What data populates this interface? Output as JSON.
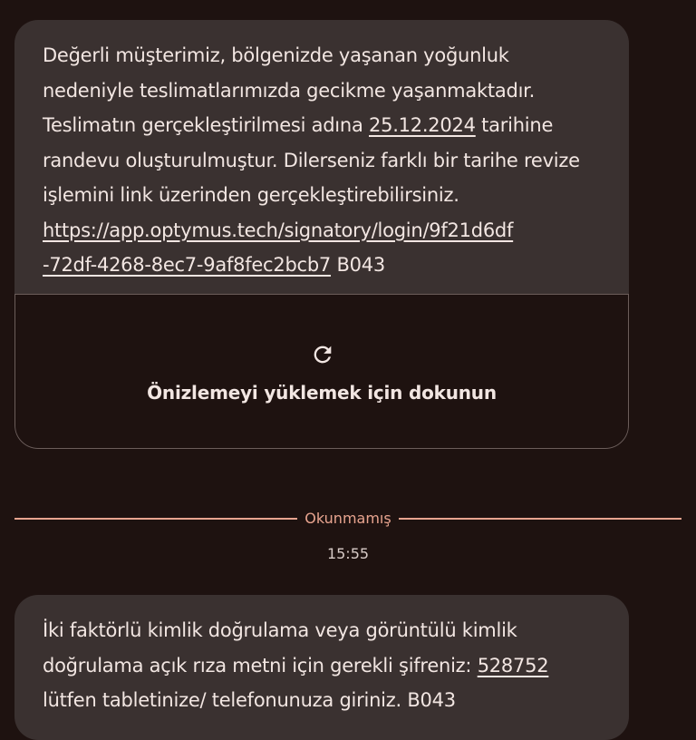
{
  "messages": [
    {
      "text_before_date": "Değerli müşterimiz, bölgenizde yaşanan yoğunluk nedeniyle teslimatlarımızda gecikme yaşanmaktadır. Teslimatın gerçekleştirilmesi adına ",
      "date_link": "25.12.2024",
      "text_after_date": " tarihine randevu oluşturulmuştur. Dilerseniz farklı bir tarihe revize işlemini link üzerinden gerçekleştirebilirsiniz. ",
      "url_line1": "https://app.optymus.tech/signatory/login/9f21d6df",
      "url_line2": "-72df-4268-8ec7-9af8fec2bcb7",
      "suffix": " B043",
      "preview_label": "Önizlemeyi yüklemek için dokunun"
    },
    {
      "text_before_code": "İki faktörlü kimlik doğrulama veya görüntülü kimlik doğrulama açık rıza metni için gerekli şifreniz: ",
      "code": "528752",
      "text_after_code": " lütfen tabletinize/ telefonunuza giriniz. B043"
    }
  ],
  "divider": {
    "label": "Okunmamış"
  },
  "timestamp": "15:55",
  "colors": {
    "background": "#1e1210",
    "bubble": "#3a3130",
    "accent": "#e8a48f",
    "text": "#f2e6e2"
  },
  "icons": {
    "preview": "refresh-icon"
  }
}
